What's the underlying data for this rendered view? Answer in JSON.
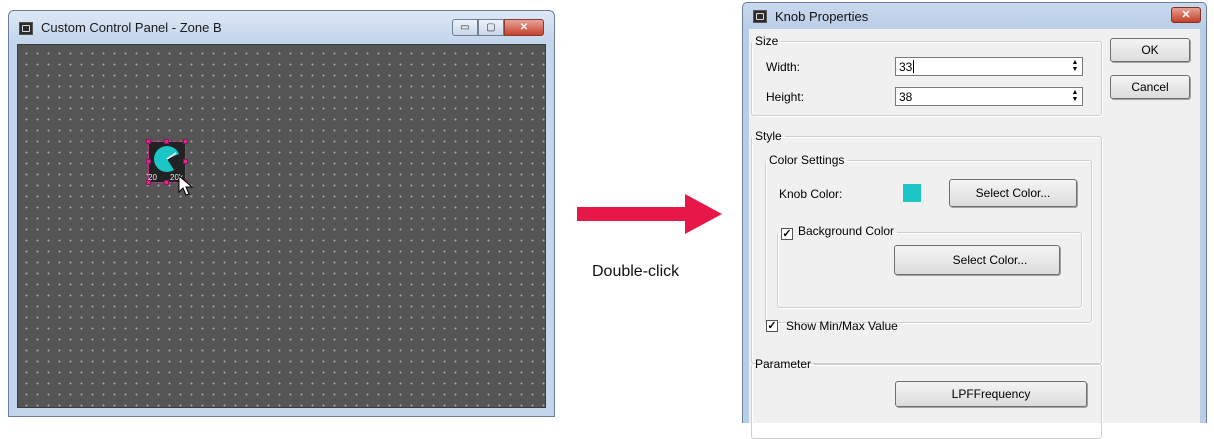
{
  "left_window": {
    "title": "Custom Control Panel - Zone B",
    "caption_buttons": {
      "minimize": "▭",
      "maximize": "▢",
      "close": "✕"
    },
    "canvas_color": "#555555",
    "knob": {
      "min_label": "20",
      "max_label": "20k",
      "knob_color": "#1cc6c6",
      "background_color": "#222222"
    }
  },
  "transition": {
    "label": "Double-click",
    "arrow_color": "#e8174a"
  },
  "dialog": {
    "title": "Knob Properties",
    "close_label": "✕",
    "ok_label": "OK",
    "cancel_label": "Cancel",
    "size": {
      "legend": "Size",
      "width_label": "Width:",
      "width_value": "33",
      "height_label": "Height:",
      "height_value": "38"
    },
    "style": {
      "legend": "Style",
      "color_settings_legend": "Color Settings",
      "knob_color_label": "Knob Color:",
      "knob_color": "#1cc6c6",
      "select_color_label": "Select Color...",
      "background_color_label": "Background Color",
      "background_color_checked": true,
      "background_color": "#262626",
      "bg_select_color_label": "Select Color...",
      "show_minmax_label": "Show Min/Max Value",
      "show_minmax_checked": true
    },
    "parameter": {
      "legend": "Parameter",
      "button_label": "LPFFrequency"
    }
  }
}
